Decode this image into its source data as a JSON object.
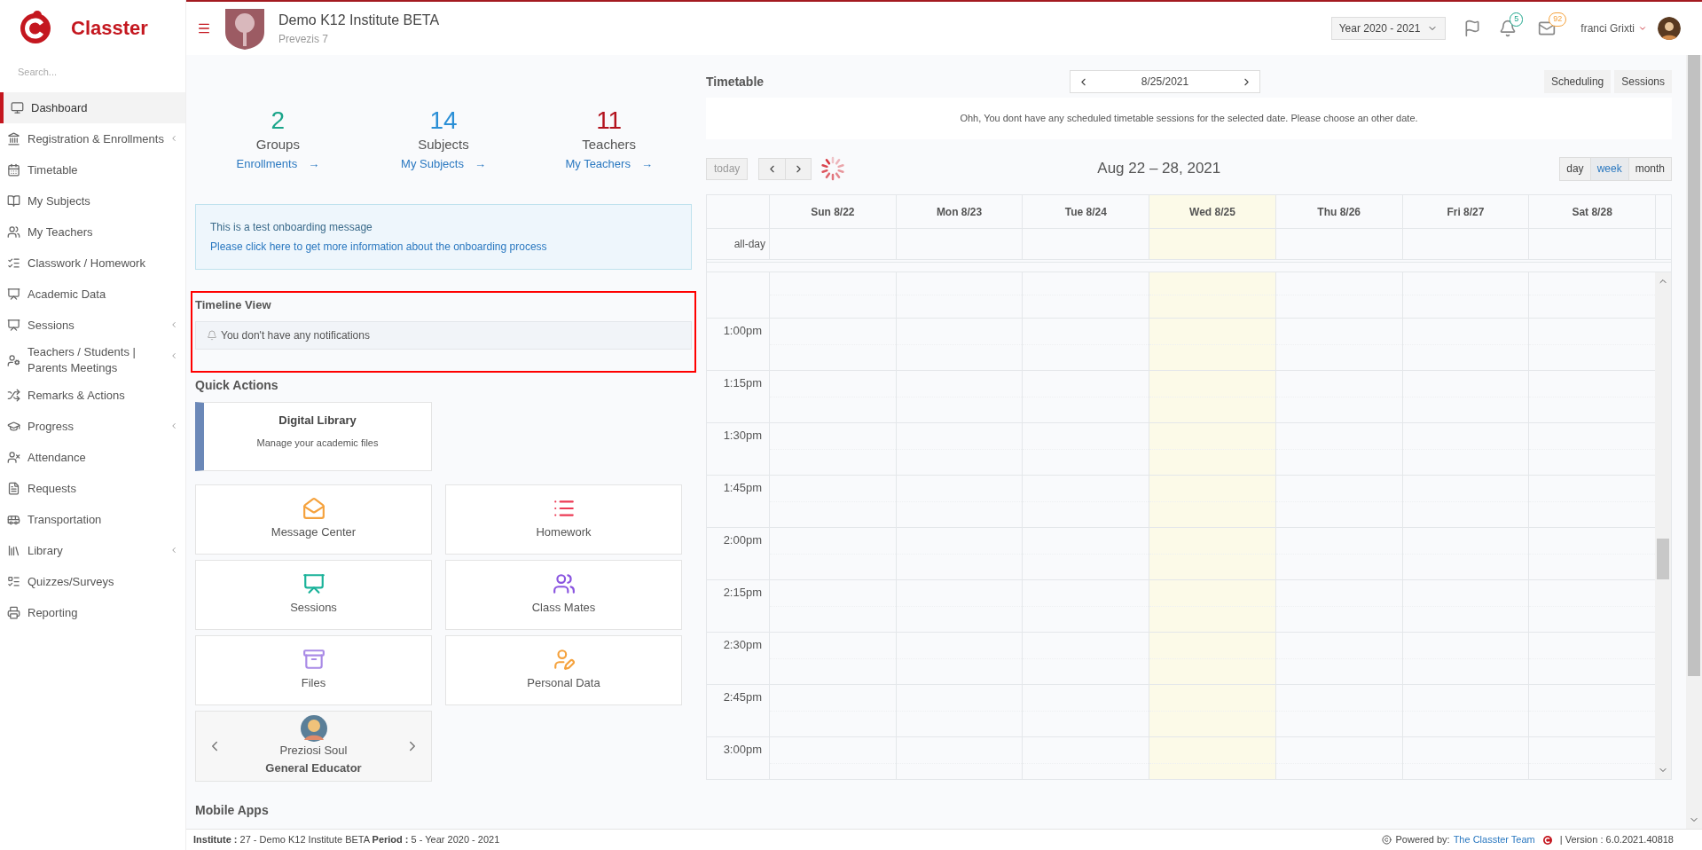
{
  "sidebar": {
    "brand": "Classter",
    "search": {
      "placeholder": "Search..."
    },
    "items": [
      {
        "label": "Dashboard",
        "selected": true,
        "expandable": false
      },
      {
        "label": "Registration & Enrollments",
        "selected": false,
        "expandable": true
      },
      {
        "label": "Timetable",
        "selected": false,
        "expandable": false
      },
      {
        "label": "My Subjects",
        "selected": false,
        "expandable": false
      },
      {
        "label": "My Teachers",
        "selected": false,
        "expandable": false
      },
      {
        "label": "Classwork / Homework",
        "selected": false,
        "expandable": false
      },
      {
        "label": "Academic Data",
        "selected": false,
        "expandable": false
      },
      {
        "label": "Sessions",
        "selected": false,
        "expandable": true
      },
      {
        "label": "Teachers / Students | Parents Meetings",
        "selected": false,
        "expandable": true
      },
      {
        "label": "Remarks & Actions",
        "selected": false,
        "expandable": false
      },
      {
        "label": "Progress",
        "selected": false,
        "expandable": true
      },
      {
        "label": "Attendance",
        "selected": false,
        "expandable": false
      },
      {
        "label": "Requests",
        "selected": false,
        "expandable": false
      },
      {
        "label": "Transportation",
        "selected": false,
        "expandable": false
      },
      {
        "label": "Library",
        "selected": false,
        "expandable": true
      },
      {
        "label": "Quizzes/Surveys",
        "selected": false,
        "expandable": false
      },
      {
        "label": "Reporting",
        "selected": false,
        "expandable": false
      }
    ]
  },
  "header": {
    "institute": "Demo K12 Institute BETA",
    "subtitle": "Prevezis 7",
    "year_select": "Year 2020 - 2021",
    "notifications_badge": "5",
    "messages_badge": "92",
    "user": "franci Grixti"
  },
  "stats": [
    {
      "value": "2",
      "label": "Groups",
      "link": "Enrollments",
      "arrow": "→",
      "color": "#1aa58a"
    },
    {
      "value": "14",
      "label": "Subjects",
      "link": "My Subjects",
      "arrow": "→",
      "color": "#2b8fd6"
    },
    {
      "value": "11",
      "label": "Teachers",
      "link": "My Teachers",
      "arrow": "→",
      "color": "#b3121d"
    }
  ],
  "onboarding": {
    "message": "This is a test onboarding message",
    "link": "Please click here to get more information about the onboarding process"
  },
  "timeline": {
    "title": "Timeline View",
    "empty": "You don't have any notifications",
    "highlighted": true
  },
  "quick_actions": {
    "title": "Quick Actions",
    "featured": {
      "title": "Digital Library",
      "subtitle": "Manage your academic files"
    },
    "tiles": [
      {
        "label": "Message Center"
      },
      {
        "label": "Homework"
      },
      {
        "label": "Sessions"
      },
      {
        "label": "Class Mates"
      },
      {
        "label": "Files"
      },
      {
        "label": "Personal Data"
      }
    ],
    "educator": {
      "name": "Preziosi Soul",
      "role": "General Educator"
    }
  },
  "mobile_apps": {
    "title": "Mobile Apps"
  },
  "timetable": {
    "title": "Timetable",
    "date": "8/25/2021",
    "buttons": [
      "Scheduling",
      "Sessions"
    ],
    "message": "Ohh, You dont have any scheduled timetable sessions for the selected date. Please choose an other date.",
    "today_button": "today",
    "range": "Aug 22 – 28, 2021",
    "views": [
      {
        "label": "day",
        "selected": false
      },
      {
        "label": "week",
        "selected": true
      },
      {
        "label": "month",
        "selected": false
      }
    ],
    "days": [
      {
        "label": "Sun 8/22",
        "today": false
      },
      {
        "label": "Mon 8/23",
        "today": false
      },
      {
        "label": "Tue 8/24",
        "today": false
      },
      {
        "label": "Wed 8/25",
        "today": true
      },
      {
        "label": "Thu 8/26",
        "today": false
      },
      {
        "label": "Fri 8/27",
        "today": false
      },
      {
        "label": "Sat 8/28",
        "today": false
      }
    ],
    "all_day": "all-day",
    "times": [
      "1:00pm",
      "1:15pm",
      "1:30pm",
      "1:45pm",
      "2:00pm",
      "2:15pm",
      "2:30pm",
      "2:45pm",
      "3:00pm"
    ]
  },
  "footer": {
    "info": "**Institute :** 27 - Demo K12 Institute BETA **Period :** 5 - Year 2020 - 2021",
    "powered": "Powered by:",
    "team": "The Classter Team",
    "version": "| Version : 6.0.2021.40818"
  }
}
